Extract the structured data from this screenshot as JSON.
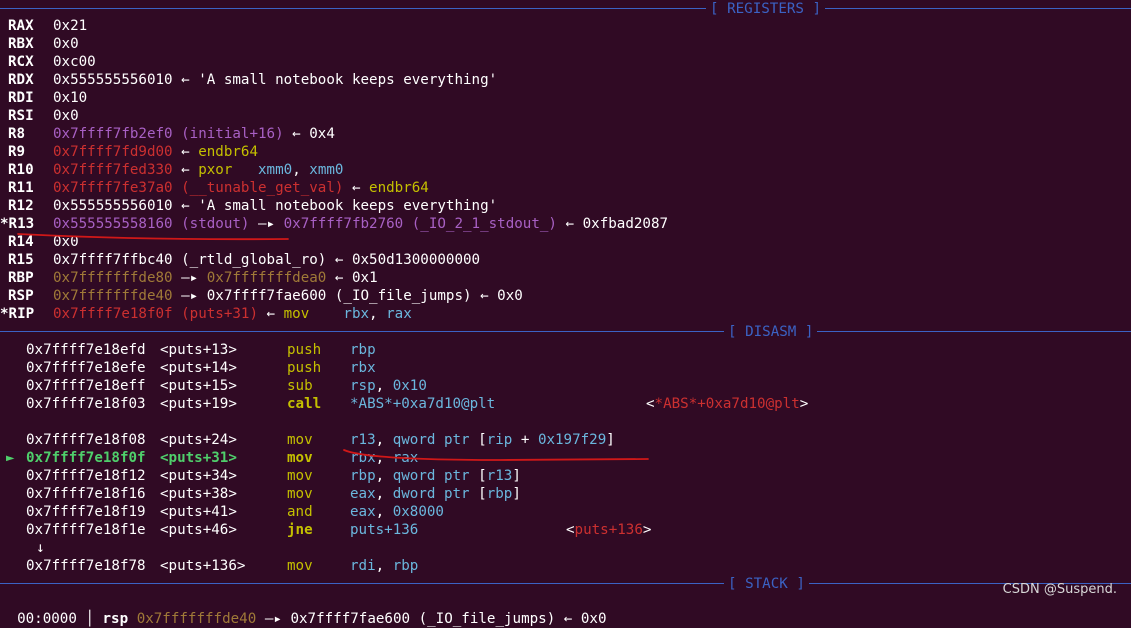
{
  "headers": {
    "registers": "[ REGISTERS ]",
    "disasm": "[ DISASM ]",
    "stack": "[ STACK ]"
  },
  "registers": [
    {
      "name": "RAX",
      "parts": [
        {
          "t": "0x21",
          "c": "white"
        }
      ]
    },
    {
      "name": "RBX",
      "parts": [
        {
          "t": "0x0",
          "c": "white"
        }
      ]
    },
    {
      "name": "RCX",
      "parts": [
        {
          "t": "0xc00",
          "c": "white"
        }
      ]
    },
    {
      "name": "RDX",
      "parts": [
        {
          "t": "0x555555556010 ← 'A small notebook keeps everything'",
          "c": "white"
        }
      ]
    },
    {
      "name": "RDI",
      "parts": [
        {
          "t": "0x10",
          "c": "white"
        }
      ]
    },
    {
      "name": "RSI",
      "parts": [
        {
          "t": "0x0",
          "c": "white"
        }
      ]
    },
    {
      "name": "R8",
      "parts": [
        {
          "t": "0x7ffff7fb2ef0 (initial+16)",
          "c": "purple"
        },
        {
          "t": " ← 0x4",
          "c": "white"
        }
      ]
    },
    {
      "name": "R9",
      "parts": [
        {
          "t": "0x7ffff7fd9d00",
          "c": "red"
        },
        {
          "t": " ← ",
          "c": "white"
        },
        {
          "t": "endbr64",
          "c": "yellow"
        }
      ]
    },
    {
      "name": "R10",
      "parts": [
        {
          "t": "0x7ffff7fed330",
          "c": "red"
        },
        {
          "t": " ← ",
          "c": "white"
        },
        {
          "t": "pxor   ",
          "c": "yellow"
        },
        {
          "t": "xmm0",
          "c": "cyan"
        },
        {
          "t": ", ",
          "c": "white"
        },
        {
          "t": "xmm0",
          "c": "cyan"
        }
      ]
    },
    {
      "name": "R11",
      "parts": [
        {
          "t": "0x7ffff7fe37a0 (__tunable_get_val)",
          "c": "red"
        },
        {
          "t": " ← ",
          "c": "white"
        },
        {
          "t": "endbr64",
          "c": "yellow"
        }
      ]
    },
    {
      "name": "R12",
      "parts": [
        {
          "t": "0x555555556010 ← 'A small notebook keeps everything'",
          "c": "white"
        }
      ]
    },
    {
      "name": "*R13",
      "parts": [
        {
          "t": "0x555555558160 (stdout)",
          "c": "purple"
        },
        {
          "t": " —▸ ",
          "c": "white"
        },
        {
          "t": "0x7ffff7fb2760 (_IO_2_1_stdout_)",
          "c": "purple"
        },
        {
          "t": " ← 0xfbad2087",
          "c": "white"
        }
      ]
    },
    {
      "name": "R14",
      "parts": [
        {
          "t": "0x0",
          "c": "white"
        }
      ]
    },
    {
      "name": "R15",
      "parts": [
        {
          "t": "0x7ffff7ffbc40 (_rtld_global_ro) ← 0x50d1300000000",
          "c": "white"
        }
      ]
    },
    {
      "name": "RBP",
      "parts": [
        {
          "t": "0x7fffffffde80",
          "c": "orange"
        },
        {
          "t": " —▸ ",
          "c": "white"
        },
        {
          "t": "0x7fffffffdea0",
          "c": "orange"
        },
        {
          "t": " ← 0x1",
          "c": "white"
        }
      ]
    },
    {
      "name": "RSP",
      "parts": [
        {
          "t": "0x7fffffffde40",
          "c": "orange"
        },
        {
          "t": " —▸ 0x7ffff7fae600 (_IO_file_jumps) ← 0x0",
          "c": "white"
        }
      ]
    },
    {
      "name": "*RIP",
      "parts": [
        {
          "t": "0x7ffff7e18f0f (puts+31)",
          "c": "red"
        },
        {
          "t": " ← ",
          "c": "white"
        },
        {
          "t": "mov    ",
          "c": "yellow"
        },
        {
          "t": "rbx",
          "c": "cyan"
        },
        {
          "t": ", ",
          "c": "white"
        },
        {
          "t": "rax",
          "c": "cyan"
        }
      ]
    }
  ],
  "disasm": [
    {
      "addr": "0x7ffff7e18efd",
      "sym": "<puts+13>",
      "op": "push",
      "args": [
        {
          "t": "rbp",
          "c": "cyan"
        }
      ]
    },
    {
      "addr": "0x7ffff7e18efe",
      "sym": "<puts+14>",
      "op": "push",
      "args": [
        {
          "t": "rbx",
          "c": "cyan"
        }
      ]
    },
    {
      "addr": "0x7ffff7e18eff",
      "sym": "<puts+15>",
      "op": "sub",
      "args": [
        {
          "t": "rsp",
          "c": "cyan"
        },
        {
          "t": ", ",
          "c": "white"
        },
        {
          "t": "0x10",
          "c": "cyan"
        }
      ]
    },
    {
      "addr": "0x7ffff7e18f03",
      "sym": "<puts+19>",
      "op": "call",
      "bold": true,
      "args": [
        {
          "t": "*ABS*+0xa7d10@plt",
          "c": "cyan"
        }
      ],
      "comment": [
        {
          "t": "<",
          "c": "white"
        },
        {
          "t": "*ABS*+0xa7d10@plt",
          "c": "red"
        },
        {
          "t": ">",
          "c": "white"
        }
      ],
      "commentLeft": 646
    },
    {
      "blank": true
    },
    {
      "addr": "0x7ffff7e18f08",
      "sym": "<puts+24>",
      "op": "mov",
      "args": [
        {
          "t": "r13",
          "c": "cyan"
        },
        {
          "t": ", ",
          "c": "white"
        },
        {
          "t": "qword ptr",
          "c": "cyan"
        },
        {
          "t": " [",
          "c": "white"
        },
        {
          "t": "rip",
          "c": "cyan"
        },
        {
          "t": " + ",
          "c": "white"
        },
        {
          "t": "0x197f29",
          "c": "cyan"
        },
        {
          "t": "]",
          "c": "white"
        }
      ]
    },
    {
      "addr": "0x7ffff7e18f0f",
      "sym": "<puts+31>",
      "op": "mov",
      "current": true,
      "marker": "►",
      "args": [
        {
          "t": "rbx",
          "c": "cyan"
        },
        {
          "t": ", ",
          "c": "white"
        },
        {
          "t": "rax",
          "c": "cyan"
        }
      ]
    },
    {
      "addr": "0x7ffff7e18f12",
      "sym": "<puts+34>",
      "op": "mov",
      "args": [
        {
          "t": "rbp",
          "c": "cyan"
        },
        {
          "t": ", ",
          "c": "white"
        },
        {
          "t": "qword ptr",
          "c": "cyan"
        },
        {
          "t": " [",
          "c": "white"
        },
        {
          "t": "r13",
          "c": "cyan"
        },
        {
          "t": "]",
          "c": "white"
        }
      ]
    },
    {
      "addr": "0x7ffff7e18f16",
      "sym": "<puts+38>",
      "op": "mov",
      "args": [
        {
          "t": "eax",
          "c": "cyan"
        },
        {
          "t": ", ",
          "c": "white"
        },
        {
          "t": "dword ptr",
          "c": "cyan"
        },
        {
          "t": " [",
          "c": "white"
        },
        {
          "t": "rbp",
          "c": "cyan"
        },
        {
          "t": "]",
          "c": "white"
        }
      ]
    },
    {
      "addr": "0x7ffff7e18f19",
      "sym": "<puts+41>",
      "op": "and",
      "args": [
        {
          "t": "eax",
          "c": "cyan"
        },
        {
          "t": ", ",
          "c": "white"
        },
        {
          "t": "0x8000",
          "c": "cyan"
        }
      ]
    },
    {
      "addr": "0x7ffff7e18f1e",
      "sym": "<puts+46>",
      "op": "jne",
      "bold": true,
      "args": [
        {
          "t": "puts+136",
          "c": "cyan"
        }
      ],
      "comment": [
        {
          "t": "<",
          "c": "white"
        },
        {
          "t": "puts+136",
          "c": "red"
        },
        {
          "t": ">",
          "c": "white"
        }
      ],
      "commentLeft": 566
    },
    {
      "arrow": "↓"
    },
    {
      "addr": "0x7ffff7e18f78",
      "sym": "<puts+136>",
      "op": "mov",
      "args": [
        {
          "t": "rdi",
          "c": "cyan"
        },
        {
          "t": ", ",
          "c": "white"
        },
        {
          "t": "rbp",
          "c": "cyan"
        }
      ]
    }
  ],
  "stack": {
    "offset": "00:0000",
    "reg": "rsp",
    "parts": [
      {
        "t": "0x7fffffffde40",
        "c": "orange"
      },
      {
        "t": " —▸ 0x7ffff7fae600 (_IO_file_jumps) ← 0x0",
        "c": "white"
      }
    ]
  },
  "watermark": "CSDN @Suspend.",
  "colors": {
    "background": "#300a24",
    "header": "#3b62c4",
    "annotation": "#d01818"
  }
}
